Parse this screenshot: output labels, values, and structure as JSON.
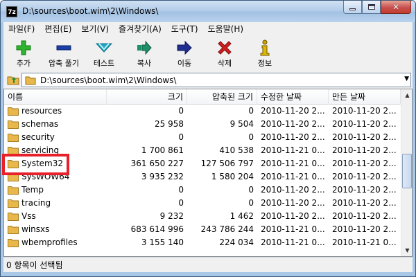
{
  "window": {
    "title": "D:\\sources\\boot.wim\\2\\Windows\\",
    "app_icon_text": "7z"
  },
  "menu": [
    "파일(F)",
    "편집(E)",
    "보기(V)",
    "즐겨찾기(A)",
    "도구(T)",
    "도움말(H)"
  ],
  "toolbar": [
    {
      "label": "추가",
      "icon": "plus-icon",
      "color": "#2fb22f"
    },
    {
      "label": "압축 풀기",
      "icon": "minus-icon",
      "color": "#1b3fa8"
    },
    {
      "label": "테스트",
      "icon": "check-icon",
      "color": "#21a6c4"
    },
    {
      "label": "복사",
      "icon": "copy-arrow-icon",
      "color": "#1f8f6a"
    },
    {
      "label": "이동",
      "icon": "move-arrow-icon",
      "color": "#1e2f8f"
    },
    {
      "label": "삭제",
      "icon": "delete-x-icon",
      "color": "#d11f1f"
    },
    {
      "label": "정보",
      "icon": "info-icon",
      "color": "#c9a300"
    }
  ],
  "address": {
    "path": "D:\\sources\\boot.wim\\2\\Windows\\"
  },
  "columns": [
    "이름",
    "크기",
    "압축된 크기",
    "수정한 날짜",
    "만든 날짜"
  ],
  "rows": [
    {
      "name": "resources",
      "size": "0",
      "packed": "0",
      "modified": "2010-11-20 2...",
      "created": "2010-11-20 2..."
    },
    {
      "name": "schemas",
      "size": "25 958",
      "packed": "9 504",
      "modified": "2010-11-20 2...",
      "created": "2010-11-20 2..."
    },
    {
      "name": "security",
      "size": "0",
      "packed": "0",
      "modified": "2010-11-20 2...",
      "created": "2010-11-20 2..."
    },
    {
      "name": "servicing",
      "size": "1 700 861",
      "packed": "410 538",
      "modified": "2010-11-21 0...",
      "created": "2010-11-20 2..."
    },
    {
      "name": "System32",
      "size": "361 650 227",
      "packed": "127 506 797",
      "modified": "2010-11-21 0...",
      "created": "2010-11-20 2..."
    },
    {
      "name": "SysWOW64",
      "size": "3 935 232",
      "packed": "1 580 204",
      "modified": "2010-11-21 0...",
      "created": "2010-11-20 2..."
    },
    {
      "name": "Temp",
      "size": "0",
      "packed": "0",
      "modified": "2010-11-20 2...",
      "created": "2010-11-20 2..."
    },
    {
      "name": "tracing",
      "size": "0",
      "packed": "0",
      "modified": "2010-11-20 2...",
      "created": "2010-11-20 2..."
    },
    {
      "name": "Vss",
      "size": "9 232",
      "packed": "1 462",
      "modified": "2010-11-20 2...",
      "created": "2010-11-20 2..."
    },
    {
      "name": "winsxs",
      "size": "683 614 996",
      "packed": "243 786 244",
      "modified": "2010-11-21 0...",
      "created": "2010-11-20 2..."
    },
    {
      "name": "wbemprofiles",
      "size": "3 155 140",
      "packed": "224 034",
      "modified": "2010-11-21 0...",
      "created": "2010-11-21 0..."
    }
  ],
  "status": "0 항목이 선택됨",
  "colors": {
    "highlight": "#e8202a",
    "folder": "#e8b84a"
  }
}
